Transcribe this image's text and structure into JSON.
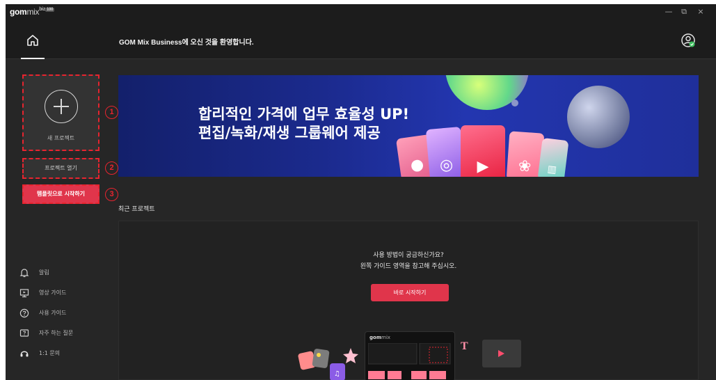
{
  "titlebar": {
    "logo_gom": "gom",
    "logo_mix": "mix",
    "logo_biz": "biz",
    "logo_tag": "100",
    "minimize": "—",
    "restore": "⧉",
    "close": "×"
  },
  "header": {
    "welcome": "GOM Mix Business에 오신 것을 환영합니다."
  },
  "sidebar": {
    "new_project": "새 프로젝트",
    "open_project": "프로젝트 열기",
    "template_start": "템플릿으로 시작하기",
    "markers": [
      "1",
      "2",
      "3"
    ],
    "links": [
      {
        "label": "알림",
        "icon": "bell-icon"
      },
      {
        "label": "영상 가이드",
        "icon": "monitor-icon"
      },
      {
        "label": "사용 가이드",
        "icon": "help-circle-icon"
      },
      {
        "label": "자주 하는 질문",
        "icon": "faq-icon"
      },
      {
        "label": "1:1 문의",
        "icon": "headset-icon"
      }
    ]
  },
  "banner": {
    "line1": "합리적인 가격에 업무 효율성 UP!",
    "line2": "편집/녹화/재생 그룹웨어 제공"
  },
  "recent": {
    "title": "최근 프로젝트",
    "help_line1": "사용 방법이 궁금하신가요?",
    "help_line2": "왼쪽 가이드 영역을 참고해 주십시오.",
    "start_button": "바로 시작하기"
  },
  "colors": {
    "accent": "#e0354b",
    "dashed_highlight": "#e8242f",
    "background": "#262626"
  }
}
